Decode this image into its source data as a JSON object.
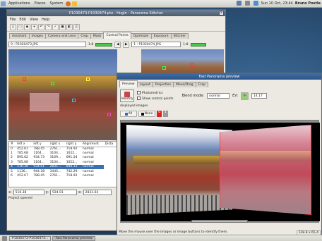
{
  "top_panel": {
    "menus": [
      "Applications",
      "Places",
      "System"
    ],
    "clock": "Sun 10 Oct, 23:44",
    "user": "Bruno Postle"
  },
  "main_window": {
    "title": "P1030473-P1030474.pto - Hugin - Panorama Stitcher",
    "menus": [
      "File",
      "Edit",
      "View",
      "Help"
    ],
    "tabs": [
      "Assistant",
      "Images",
      "Camera and Lens",
      "Crop",
      "Mask",
      "Control Points",
      "Optimizer",
      "Exposure",
      "Stitcher"
    ],
    "selected_tab": "Control Points",
    "left_image": "0 : P1030473.JPG",
    "left_zoom": "1:8",
    "right_image": "1 : P1030474.JPG",
    "right_zoom": "1:8",
    "table_headers": [
      "#",
      "left x",
      "left y",
      "right x",
      "right y",
      "Alignment",
      "Dista"
    ],
    "rows": [
      [
        "0",
        "452.61",
        "788.45",
        "2761...",
        "718.92",
        "normal"
      ],
      [
        "1",
        "785.68",
        "1164...",
        "3104...",
        "1022...",
        "normal"
      ],
      [
        "2",
        "895.62",
        "934.73",
        "3169...",
        "691.54",
        "normal"
      ],
      [
        "3",
        "785.68",
        "1164...",
        "3104...",
        "1022...",
        "normal"
      ],
      [
        "4",
        "516.38",
        "934.01",
        "2831...",
        "840.13",
        "normal"
      ],
      [
        "5",
        "1136...",
        "944.38",
        "3445...",
        "742.29",
        "normal"
      ],
      [
        "6",
        "452.67",
        "788.45",
        "2761...",
        "718.92",
        "normal"
      ]
    ],
    "selected_row": 4,
    "x_label": "x:",
    "x_value": "516.38",
    "y_label": "y:",
    "y_value": "934.01",
    "x2_label": "x:",
    "x2_value": "2831.64",
    "status": "Project opened"
  },
  "preview_window": {
    "title": "Fast Panorama preview",
    "tabs": [
      "Preview",
      "Layout",
      "Projection",
      "Move/Drag",
      "Crop"
    ],
    "selected_tab": "Preview",
    "identify_label": "Identify",
    "photometrics_label": "Photometrics",
    "show_cp_label": "Show control points",
    "blend_mode_label": "Blend mode:",
    "blend_mode_value": "normal",
    "ev_label": "EV:",
    "ev_value": "14.17",
    "displayed_images_label": "displayed images",
    "all_label": "All",
    "none_label": "None",
    "img_buttons": [
      "0",
      "1"
    ],
    "status": "Move the mouse over the images or image buttons to identify them.",
    "fov": "128.8 x 65.4"
  },
  "taskbar": {
    "items": [
      "P1030473-P1030474...",
      "Fast Panorama preview"
    ]
  }
}
